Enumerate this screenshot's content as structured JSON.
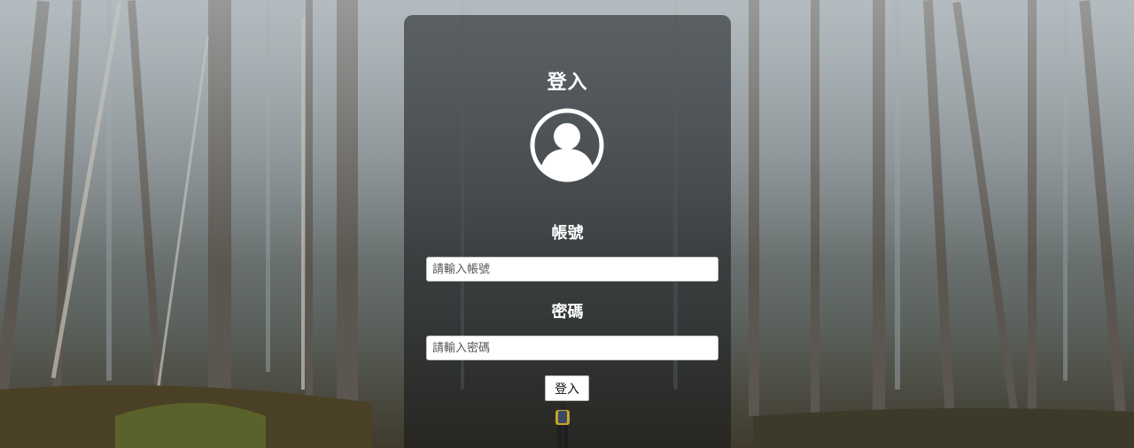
{
  "login": {
    "title": "登入",
    "avatar_icon": "user-avatar-icon",
    "account_label": "帳號",
    "account_placeholder": "請輸入帳號",
    "account_value": "",
    "password_label": "密碼",
    "password_placeholder": "請輸入密碼",
    "password_value": "",
    "submit_label": "登入"
  },
  "colors": {
    "panel": "#14161a",
    "text": "#ffffff",
    "input_bg": "#ffffff"
  }
}
